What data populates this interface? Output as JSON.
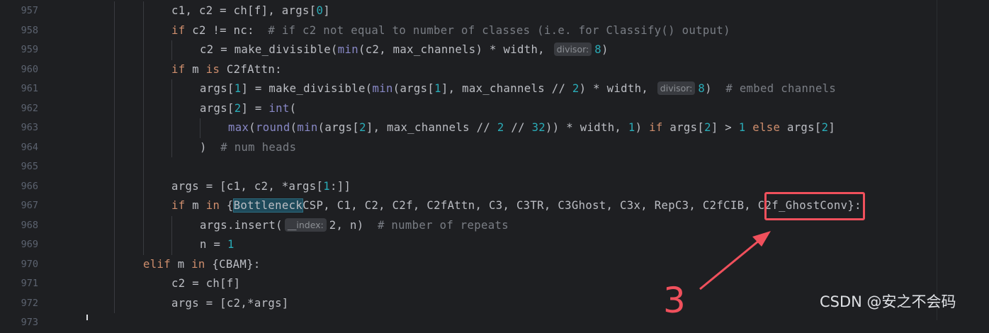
{
  "editor": {
    "lines": [
      {
        "num": "957",
        "segs": [
          [
            "c1, c2 = ch[f], args[",
            ""
          ],
          [
            "0",
            "num"
          ],
          [
            "]",
            ""
          ]
        ]
      },
      {
        "num": "958",
        "segs": [
          [
            "if",
            "kw"
          ],
          [
            " c2 != nc:  ",
            ""
          ],
          [
            "# if c2 not equal to number of classes (i.e. for Classify() output)",
            "cm"
          ]
        ]
      },
      {
        "num": "959",
        "segs": [
          [
            "c2 = make_divisible(",
            ""
          ],
          [
            "min",
            "bi"
          ],
          [
            "(c2, max_channels) * width, ",
            ""
          ],
          [
            "divisor:",
            "hint"
          ],
          [
            "8",
            "num"
          ],
          [
            ")",
            ""
          ]
        ]
      },
      {
        "num": "960",
        "segs": [
          [
            "if",
            "kw"
          ],
          [
            " m ",
            ""
          ],
          [
            "is",
            "kw"
          ],
          [
            " C2fAttn:",
            ""
          ]
        ]
      },
      {
        "num": "961",
        "segs": [
          [
            "args[",
            ""
          ],
          [
            "1",
            "num"
          ],
          [
            "] = make_divisible(",
            ""
          ],
          [
            "min",
            "bi"
          ],
          [
            "(args[",
            ""
          ],
          [
            "1",
            "num"
          ],
          [
            "], max_channels // ",
            ""
          ],
          [
            "2",
            "num"
          ],
          [
            ") * width, ",
            ""
          ],
          [
            "divisor:",
            "hint"
          ],
          [
            "8",
            "num"
          ],
          [
            ")  ",
            ""
          ],
          [
            "# embed channels",
            "cm"
          ]
        ]
      },
      {
        "num": "962",
        "segs": [
          [
            "args[",
            ""
          ],
          [
            "2",
            "num"
          ],
          [
            "] = ",
            ""
          ],
          [
            "int",
            "bi"
          ],
          [
            "(",
            ""
          ]
        ]
      },
      {
        "num": "963",
        "segs": [
          [
            "max",
            "bi"
          ],
          [
            "(",
            ""
          ],
          [
            "round",
            "bi"
          ],
          [
            "(",
            ""
          ],
          [
            "min",
            "bi"
          ],
          [
            "(args[",
            ""
          ],
          [
            "2",
            "num"
          ],
          [
            "], max_channels // ",
            ""
          ],
          [
            "2",
            "num"
          ],
          [
            " // ",
            ""
          ],
          [
            "32",
            "num"
          ],
          [
            ")) * width, ",
            ""
          ],
          [
            "1",
            "num"
          ],
          [
            ") ",
            ""
          ],
          [
            "if",
            "kw"
          ],
          [
            " args[",
            ""
          ],
          [
            "2",
            "num"
          ],
          [
            "] > ",
            ""
          ],
          [
            "1",
            "num"
          ],
          [
            " ",
            ""
          ],
          [
            "else",
            "kw"
          ],
          [
            " args[",
            ""
          ],
          [
            "2",
            "num"
          ],
          [
            "]",
            ""
          ]
        ]
      },
      {
        "num": "964",
        "segs": [
          [
            ")  ",
            ""
          ],
          [
            "# num heads",
            "cm"
          ]
        ]
      },
      {
        "num": "965",
        "segs": []
      },
      {
        "num": "966",
        "segs": [
          [
            "args = [c1, c2, *args[",
            ""
          ],
          [
            "1",
            "num"
          ],
          [
            ":]]",
            ""
          ]
        ]
      },
      {
        "num": "967",
        "segs": [
          [
            "if",
            "kw"
          ],
          [
            " m ",
            ""
          ],
          [
            "in",
            "kw"
          ],
          [
            " {",
            ""
          ],
          [
            "Bottleneck",
            "hl"
          ],
          [
            "CSP, C1, C2, C2f, C2fAttn, C3, C3TR, C3Ghost, C3x, RepC3, C2fCIB, C2f_GhostConv}:",
            ""
          ]
        ]
      },
      {
        "num": "968",
        "segs": [
          [
            "args.insert(",
            ""
          ],
          [
            "__index:",
            "hint"
          ],
          [
            "2, n)  ",
            ""
          ],
          [
            "# number of repeats",
            "cm"
          ]
        ]
      },
      {
        "num": "969",
        "segs": [
          [
            "n = ",
            ""
          ],
          [
            "1",
            "num"
          ]
        ]
      },
      {
        "num": "970",
        "segs": [
          [
            "elif",
            "kw"
          ],
          [
            " m ",
            ""
          ],
          [
            "in",
            "kw"
          ],
          [
            " {CBAM}:",
            ""
          ]
        ]
      },
      {
        "num": "971",
        "segs": [
          [
            "c2 = ch[f]",
            ""
          ]
        ]
      },
      {
        "num": "972",
        "segs": [
          [
            "args = [c2,*args]",
            ""
          ]
        ]
      },
      {
        "num": "973",
        "segs": []
      }
    ]
  },
  "annotation": {
    "number": "3",
    "color": "#f0505c"
  },
  "watermark": "CSDN @安之不会码"
}
